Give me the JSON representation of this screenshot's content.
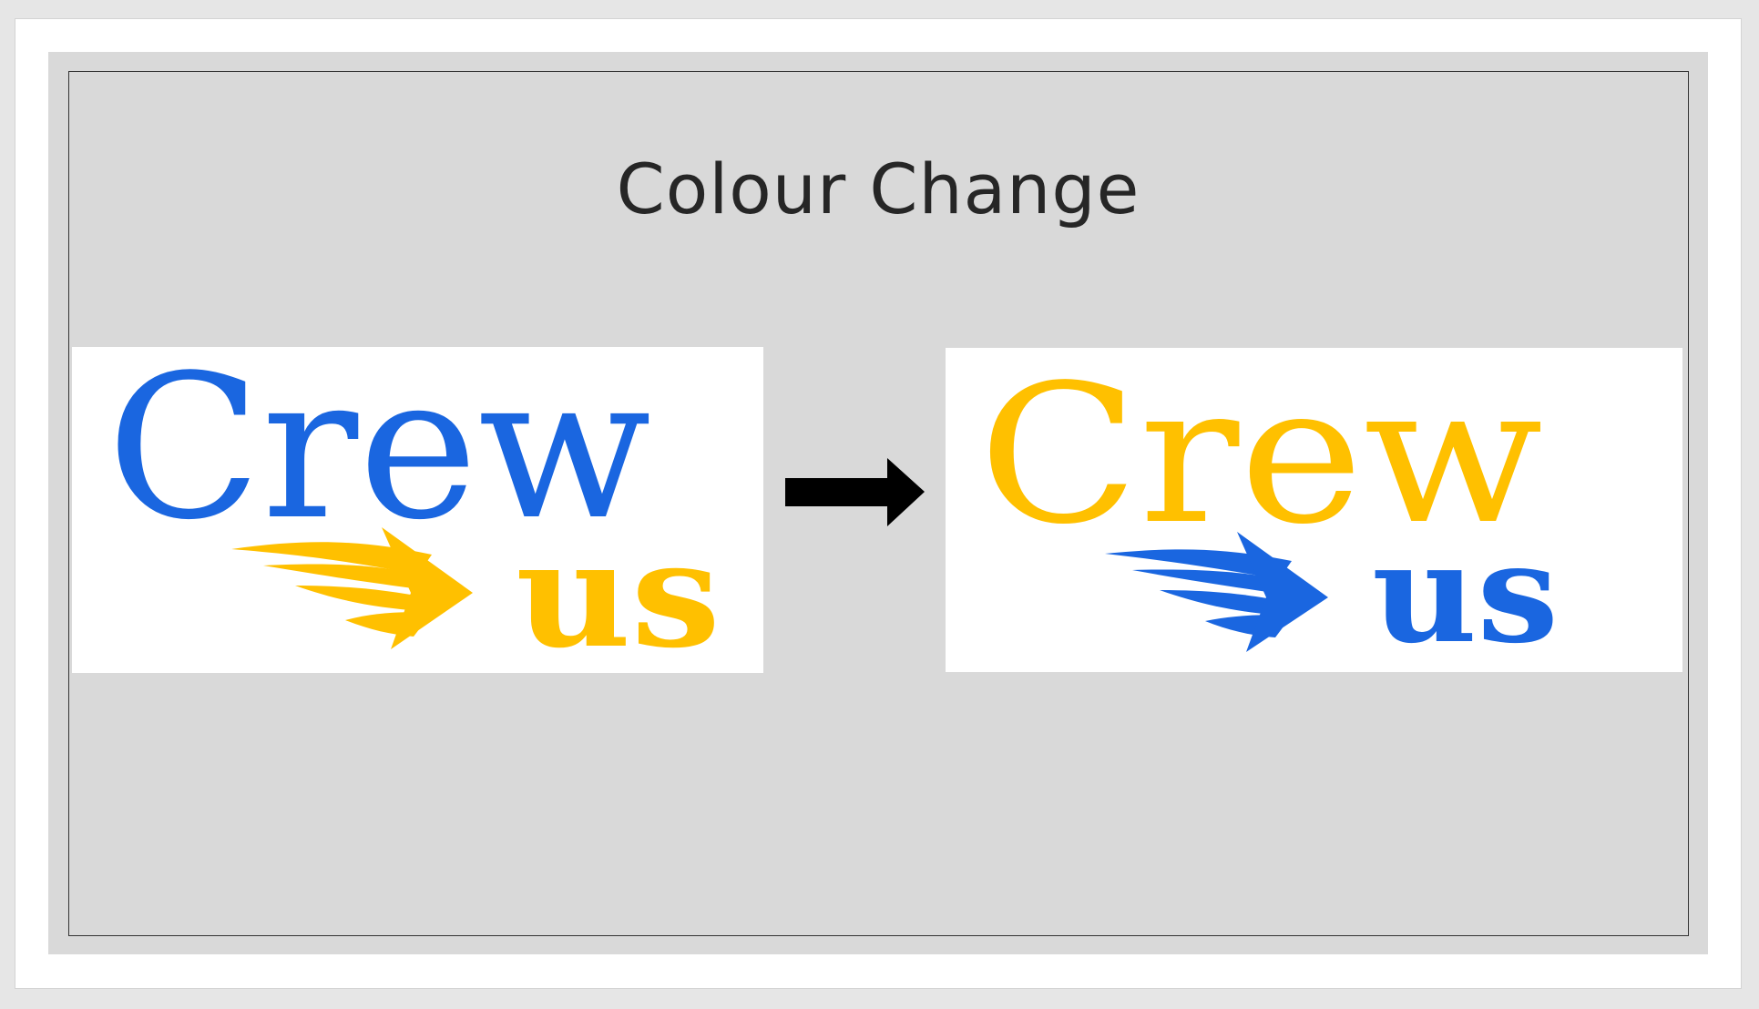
{
  "slide": {
    "title": "Colour Change"
  },
  "logo_before": {
    "word_top": "Crew",
    "word_bottom": "us",
    "word_top_color": "#1a66e0",
    "word_bottom_color": "#ffc000",
    "swoosh_color": "#ffc000",
    "background": "#ffffff"
  },
  "logo_after": {
    "word_top": "Crew",
    "word_bottom": "us",
    "word_top_color": "#ffc000",
    "word_bottom_color": "#1a66e0",
    "swoosh_color": "#1a66e0",
    "background": "#ffffff"
  },
  "transition_arrow": {
    "icon": "right-arrow-icon",
    "color": "#000000"
  }
}
